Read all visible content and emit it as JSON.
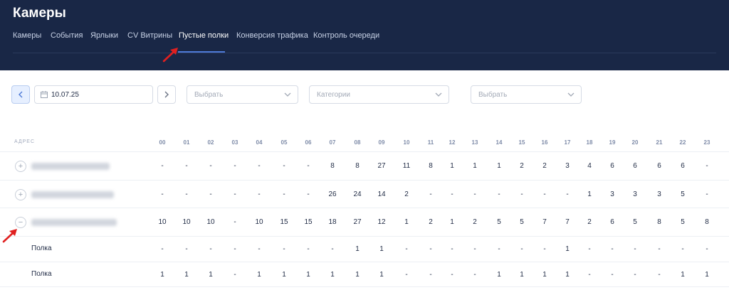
{
  "header": {
    "title": "Камеры",
    "tabs": [
      {
        "label": "Камеры",
        "active": false
      },
      {
        "label": "События",
        "active": false
      },
      {
        "label": "Ярлыки",
        "active": false
      },
      {
        "label": "CV Витрины",
        "active": false
      },
      {
        "label": "Пустые полки",
        "active": true
      },
      {
        "label": "Конверсия трафика",
        "active": false
      },
      {
        "label": "Контроль очереди",
        "active": false
      }
    ]
  },
  "filters": {
    "prev_icon": "chevron-left-icon",
    "next_icon": "chevron-right-icon",
    "date": "10.07.25",
    "select1": "Выбрать",
    "select2": "Категории",
    "select3": "Выбрать"
  },
  "table": {
    "address_header": "АДРЕС",
    "hours": [
      "00",
      "01",
      "02",
      "03",
      "04",
      "05",
      "06",
      "07",
      "08",
      "09",
      "10",
      "11",
      "12",
      "13",
      "14",
      "15",
      "16",
      "17",
      "18",
      "19",
      "20",
      "21",
      "22",
      "23"
    ],
    "rows": [
      {
        "toggle": "+",
        "label": "",
        "values": [
          "-",
          "-",
          "-",
          "-",
          "-",
          "-",
          "-",
          "8",
          "8",
          "27",
          "11",
          "8",
          "1",
          "1",
          "1",
          "2",
          "2",
          "3",
          "4",
          "6",
          "6",
          "6",
          "6",
          "-"
        ]
      },
      {
        "toggle": "+",
        "label": "",
        "values": [
          "-",
          "-",
          "-",
          "-",
          "-",
          "-",
          "-",
          "26",
          "24",
          "14",
          "2",
          "-",
          "-",
          "-",
          "-",
          "-",
          "-",
          "-",
          "1",
          "3",
          "3",
          "3",
          "5",
          "-"
        ]
      },
      {
        "toggle": "−",
        "label": "",
        "values": [
          "10",
          "10",
          "10",
          "-",
          "10",
          "15",
          "15",
          "18",
          "27",
          "12",
          "1",
          "2",
          "1",
          "2",
          "5",
          "5",
          "7",
          "7",
          "2",
          "6",
          "5",
          "8",
          "5",
          "8"
        ]
      },
      {
        "toggle": "",
        "label": "Полка",
        "values": [
          "-",
          "-",
          "-",
          "-",
          "-",
          "-",
          "-",
          "-",
          "1",
          "1",
          "-",
          "-",
          "-",
          "-",
          "-",
          "-",
          "-",
          "1",
          "-",
          "-",
          "-",
          "-",
          "-",
          "-"
        ]
      },
      {
        "toggle": "",
        "label": "Полка",
        "values": [
          "1",
          "1",
          "1",
          "-",
          "1",
          "1",
          "1",
          "1",
          "1",
          "1",
          "-",
          "-",
          "-",
          "-",
          "1",
          "1",
          "1",
          "1",
          "-",
          "-",
          "-",
          "-",
          "1",
          "1"
        ]
      }
    ]
  },
  "colors": {
    "header_bg": "#192746",
    "accent": "#4d79d6",
    "annotation_arrow": "#e02020"
  }
}
